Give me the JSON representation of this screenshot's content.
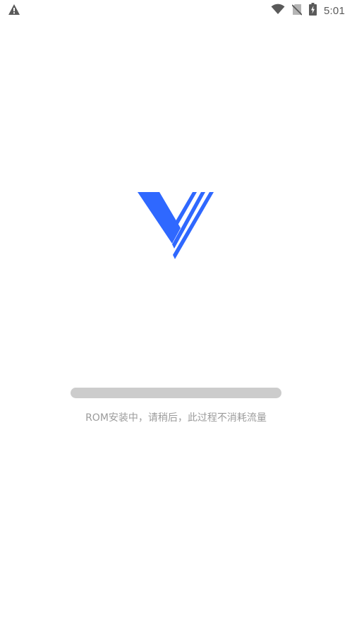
{
  "status_bar": {
    "time": "5:01",
    "icons": {
      "left": "warning-icon",
      "wifi": "wifi-icon",
      "sim": "no-sim-icon",
      "battery": "battery-charging-icon"
    }
  },
  "splash": {
    "logo": "v-logo-icon",
    "accent_color": "#2f68ff"
  },
  "progress": {
    "percent": 0
  },
  "message": "ROM安装中，请稍后，此过程不消耗流量"
}
